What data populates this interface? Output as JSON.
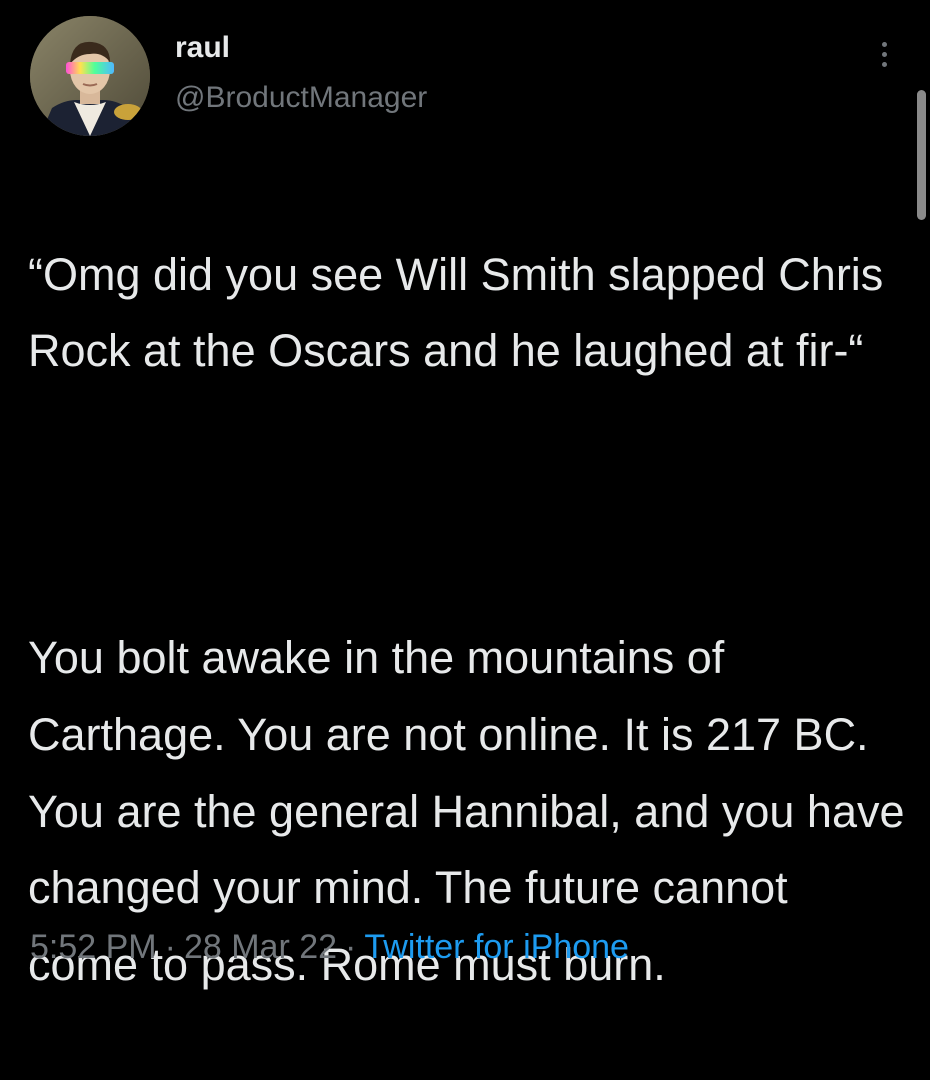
{
  "tweet": {
    "display_name": "raul",
    "handle": "@BroductManager",
    "paragraph1": "“Omg did you see Will Smith slapped Chris Rock at the Oscars and he laughed at fir-“",
    "paragraph2": "You bolt awake in the mountains of Carthage. You are not online. It is 217 BC. You are the general Hannibal, and you have changed your mind. The future cannot come to pass. Rome must burn.",
    "time": "5:52 PM",
    "date": "28 Mar 22",
    "separator": "·",
    "source": "Twitter for iPhone"
  },
  "icons": {
    "more": "more-options-icon",
    "avatar": "avatar-image"
  },
  "colors": {
    "background": "#000000",
    "text": "#e7e9ea",
    "secondary": "#71767b",
    "link": "#1d9bf0"
  }
}
